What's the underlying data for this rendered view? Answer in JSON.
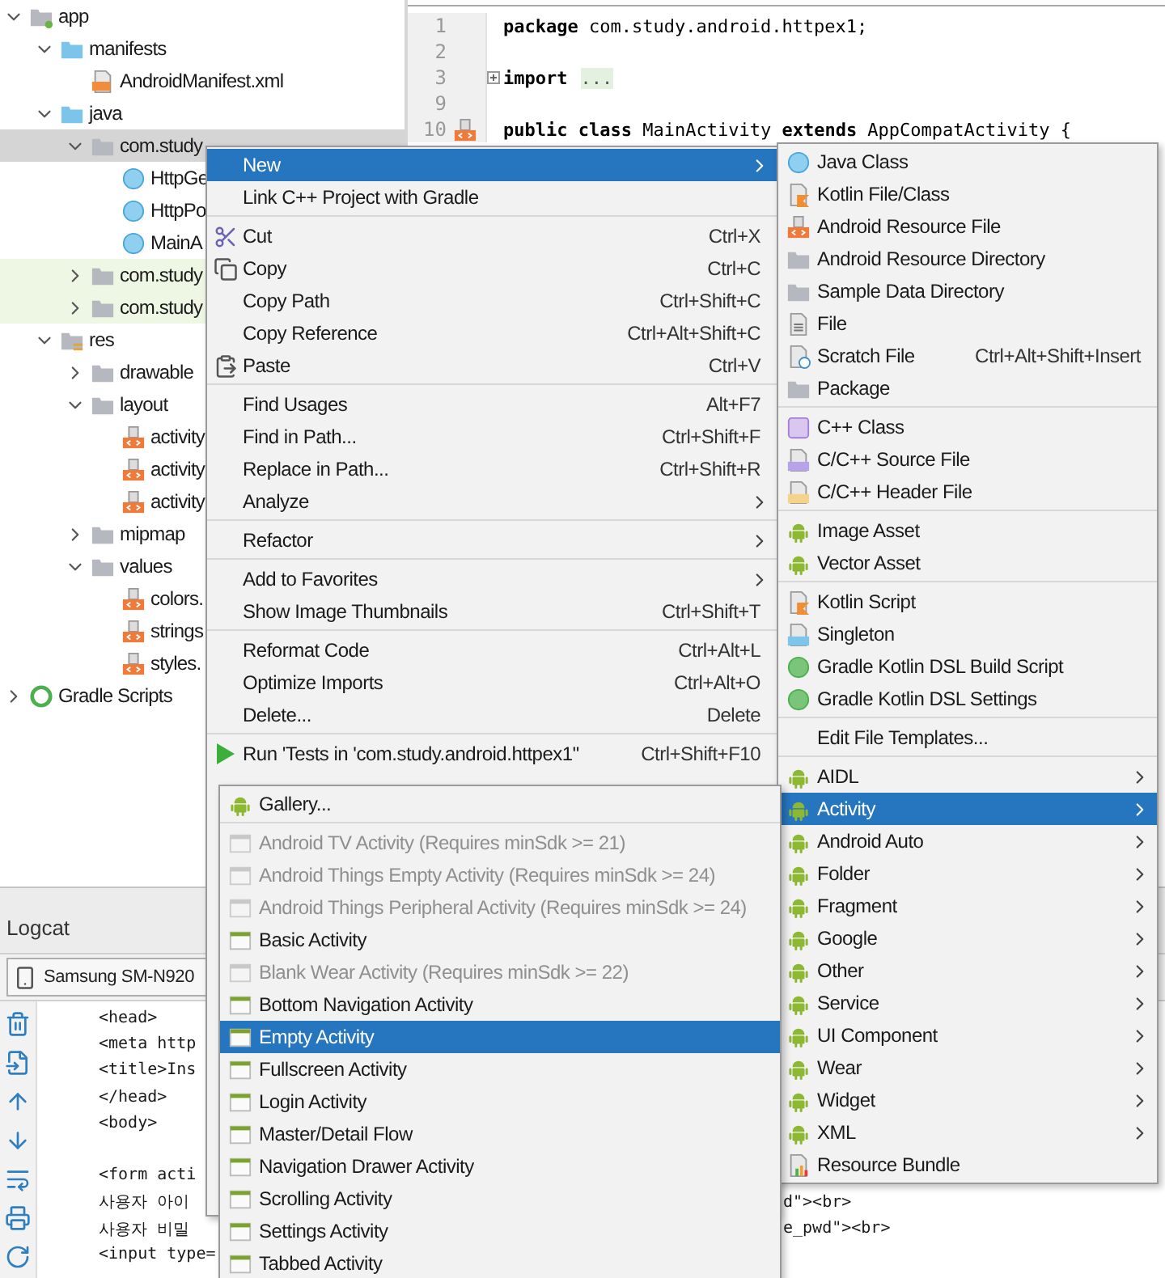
{
  "project_tree": {
    "items": [
      {
        "label": "app",
        "kind": "module",
        "expanded": true,
        "selected": false,
        "children": [
          {
            "label": "manifests",
            "kind": "source-folder",
            "expanded": true,
            "selected": false,
            "children": [
              {
                "label": "AndroidManifest.xml",
                "kind": "manifest",
                "selected": false
              }
            ]
          },
          {
            "label": "java",
            "kind": "source-folder",
            "expanded": true,
            "selected": false,
            "children": [
              {
                "label": "com.study",
                "kind": "package",
                "expanded": true,
                "selected": true,
                "children": [
                  {
                    "label": "HttpGe",
                    "kind": "class",
                    "selected": false
                  },
                  {
                    "label": "HttpPo",
                    "kind": "class",
                    "selected": false
                  },
                  {
                    "label": "MainA",
                    "kind": "class",
                    "selected": false
                  }
                ]
              },
              {
                "label": "com.study",
                "kind": "test-package",
                "expanded": false,
                "selected": false
              },
              {
                "label": "com.study",
                "kind": "test-package",
                "expanded": false,
                "selected": false
              }
            ]
          },
          {
            "label": "res",
            "kind": "res-folder",
            "expanded": true,
            "selected": false,
            "children": [
              {
                "label": "drawable",
                "kind": "package",
                "expanded": false,
                "selected": false
              },
              {
                "label": "layout",
                "kind": "package",
                "expanded": true,
                "selected": false,
                "children": [
                  {
                    "label": "activity",
                    "kind": "resource",
                    "selected": false
                  },
                  {
                    "label": "activity",
                    "kind": "resource",
                    "selected": false
                  },
                  {
                    "label": "activity",
                    "kind": "resource",
                    "selected": false
                  }
                ]
              },
              {
                "label": "mipmap",
                "kind": "package",
                "expanded": false,
                "selected": false
              },
              {
                "label": "values",
                "kind": "package",
                "expanded": true,
                "selected": false,
                "children": [
                  {
                    "label": "colors.",
                    "kind": "resource",
                    "selected": false
                  },
                  {
                    "label": "strings",
                    "kind": "resource",
                    "selected": false
                  },
                  {
                    "label": "styles.",
                    "kind": "resource",
                    "selected": false
                  }
                ]
              }
            ]
          }
        ]
      },
      {
        "label": "Gradle Scripts",
        "kind": "gradle",
        "expanded": false,
        "selected": false
      }
    ]
  },
  "editor": {
    "lines": [
      {
        "number": "1",
        "code": "**package** com.study.android.httpex1;"
      },
      {
        "number": "2"
      },
      {
        "number": "3",
        "folded": true,
        "code": "**import**",
        "folded_text": "..."
      },
      {
        "number": "9"
      },
      {
        "number": "10",
        "related_layout": true,
        "code": "**public class** MainActivity **extends** AppCompatActivity {"
      }
    ]
  },
  "logcat": {
    "title": "Logcat",
    "device": "Samsung SM-N920",
    "blocks": [
      [
        {
          "text": "<head>"
        },
        {
          "text": "<meta http"
        },
        {
          "text": "<title>Ins"
        },
        {
          "text": "</head>"
        },
        {
          "text": "<body>"
        }
      ],
      [
        {
          "text": "<form acti"
        },
        {
          "text": "사용자 아이",
          "tail": "d\"><br>"
        },
        {
          "text": "사용자 비밀",
          "tail": "e_pwd\"><br>"
        },
        {
          "text": "<input type="
        }
      ]
    ]
  },
  "context_menu": {
    "groups": [
      [
        {
          "label": "New",
          "selected": true,
          "submenu": true
        },
        {
          "label": "Link C++ Project with Gradle",
          "selected": false,
          "submenu": false
        }
      ],
      [
        {
          "label": "Cut",
          "shortcut": "Ctrl+X",
          "selected": false,
          "submenu": false
        },
        {
          "label": "Copy",
          "shortcut": "Ctrl+C",
          "selected": false,
          "submenu": false
        },
        {
          "label": "Copy Path",
          "shortcut": "Ctrl+Shift+C",
          "selected": false,
          "submenu": false
        },
        {
          "label": "Copy Reference",
          "shortcut": "Ctrl+Alt+Shift+C",
          "selected": false,
          "submenu": false
        },
        {
          "label": "Paste",
          "shortcut": "Ctrl+V",
          "selected": false,
          "submenu": false
        }
      ],
      [
        {
          "label": "Find Usages",
          "shortcut": "Alt+F7",
          "selected": false,
          "submenu": false
        },
        {
          "label": "Find in Path...",
          "shortcut": "Ctrl+Shift+F",
          "selected": false,
          "submenu": false
        },
        {
          "label": "Replace in Path...",
          "shortcut": "Ctrl+Shift+R",
          "selected": false,
          "submenu": false
        },
        {
          "label": "Analyze",
          "selected": false,
          "submenu": true
        }
      ],
      [
        {
          "label": "Refactor",
          "selected": false,
          "submenu": true
        }
      ],
      [
        {
          "label": "Add to Favorites",
          "selected": false,
          "submenu": true
        },
        {
          "label": "Show Image Thumbnails",
          "shortcut": "Ctrl+Shift+T",
          "selected": false,
          "submenu": false
        }
      ],
      [
        {
          "label": "Reformat Code",
          "shortcut": "Ctrl+Alt+L",
          "selected": false,
          "submenu": false
        },
        {
          "label": "Optimize Imports",
          "shortcut": "Ctrl+Alt+O",
          "selected": false,
          "submenu": false
        },
        {
          "label": "Delete...",
          "shortcut": "Delete",
          "selected": false,
          "submenu": false
        }
      ],
      [
        {
          "label": "Run 'Tests in 'com.study.android.httpex1''",
          "shortcut": "Ctrl+Shift+F10",
          "selected": false,
          "submenu": false
        }
      ]
    ]
  },
  "new_submenu": {
    "groups": [
      [
        {
          "label": "Java Class",
          "selected": false,
          "submenu": false
        },
        {
          "label": "Kotlin File/Class",
          "selected": false,
          "submenu": false
        },
        {
          "label": "Android Resource File",
          "selected": false,
          "submenu": false
        },
        {
          "label": "Android Resource Directory",
          "selected": false,
          "submenu": false
        },
        {
          "label": "Sample Data Directory",
          "selected": false,
          "submenu": false
        },
        {
          "label": "File",
          "selected": false,
          "submenu": false
        },
        {
          "label": "Scratch File",
          "shortcut": "Ctrl+Alt+Shift+Insert",
          "selected": false,
          "submenu": false
        },
        {
          "label": "Package",
          "selected": false,
          "submenu": false
        }
      ],
      [
        {
          "label": "C++ Class",
          "selected": false,
          "submenu": false
        },
        {
          "label": "C/C++ Source File",
          "selected": false,
          "submenu": false
        },
        {
          "label": "C/C++ Header File",
          "selected": false,
          "submenu": false
        }
      ],
      [
        {
          "label": "Image Asset",
          "selected": false,
          "submenu": false
        },
        {
          "label": "Vector Asset",
          "selected": false,
          "submenu": false
        }
      ],
      [
        {
          "label": "Kotlin Script",
          "selected": false,
          "submenu": false
        },
        {
          "label": "Singleton",
          "selected": false,
          "submenu": false
        },
        {
          "label": "Gradle Kotlin DSL Build Script",
          "selected": false,
          "submenu": false
        },
        {
          "label": "Gradle Kotlin DSL Settings",
          "selected": false,
          "submenu": false
        }
      ],
      [
        {
          "label": "Edit File Templates...",
          "selected": false,
          "submenu": false
        }
      ],
      [
        {
          "label": "AIDL",
          "selected": false,
          "submenu": true
        },
        {
          "label": "Activity",
          "selected": true,
          "submenu": true
        },
        {
          "label": "Android Auto",
          "selected": false,
          "submenu": true
        },
        {
          "label": "Folder",
          "selected": false,
          "submenu": true
        },
        {
          "label": "Fragment",
          "selected": false,
          "submenu": true
        },
        {
          "label": "Google",
          "selected": false,
          "submenu": true
        },
        {
          "label": "Other",
          "selected": false,
          "submenu": true
        },
        {
          "label": "Service",
          "selected": false,
          "submenu": true
        },
        {
          "label": "UI Component",
          "selected": false,
          "submenu": true
        },
        {
          "label": "Wear",
          "selected": false,
          "submenu": true
        },
        {
          "label": "Widget",
          "selected": false,
          "submenu": true
        },
        {
          "label": "XML",
          "selected": false,
          "submenu": true
        },
        {
          "label": "Resource Bundle",
          "selected": false,
          "submenu": false
        }
      ]
    ]
  },
  "activity_submenu": {
    "groups": [
      [
        {
          "label": "Gallery...",
          "selected": false,
          "disabled": false
        }
      ],
      [
        {
          "label": "Android TV Activity (Requires minSdk >= 21)",
          "selected": false,
          "disabled": true
        },
        {
          "label": "Android Things Empty Activity (Requires minSdk >= 24)",
          "selected": false,
          "disabled": true
        },
        {
          "label": "Android Things Peripheral Activity (Requires minSdk >= 24)",
          "selected": false,
          "disabled": true
        },
        {
          "label": "Basic Activity",
          "selected": false,
          "disabled": false
        },
        {
          "label": "Blank Wear Activity (Requires minSdk >= 22)",
          "selected": false,
          "disabled": true
        },
        {
          "label": "Bottom Navigation Activity",
          "selected": false,
          "disabled": false
        },
        {
          "label": "Empty Activity",
          "selected": true,
          "disabled": false
        },
        {
          "label": "Fullscreen Activity",
          "selected": false,
          "disabled": false
        },
        {
          "label": "Login Activity",
          "selected": false,
          "disabled": false
        },
        {
          "label": "Master/Detail Flow",
          "selected": false,
          "disabled": false
        },
        {
          "label": "Navigation Drawer Activity",
          "selected": false,
          "disabled": false
        },
        {
          "label": "Scrolling Activity",
          "selected": false,
          "disabled": false
        },
        {
          "label": "Settings Activity",
          "selected": false,
          "disabled": false
        },
        {
          "label": "Tabbed Activity",
          "selected": false,
          "disabled": false
        }
      ]
    ]
  }
}
